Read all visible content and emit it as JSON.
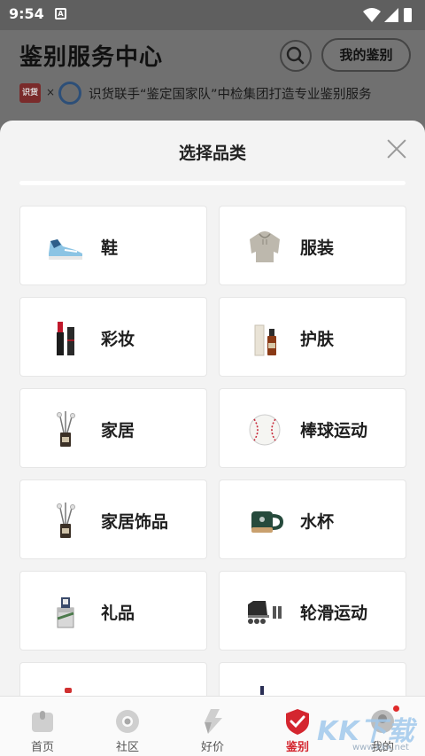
{
  "status_bar": {
    "time": "9:54",
    "notification_glyph": "A"
  },
  "background_page": {
    "title": "鉴别服务中心",
    "my_button": "我的鉴别",
    "banner_x": "×",
    "banner_text": "识货联手“鉴定国家队”中检集团打造专业鉴别服务"
  },
  "sheet": {
    "title": "选择品类",
    "categories": [
      {
        "label": "鞋",
        "icon": "sneaker-icon"
      },
      {
        "label": "服装",
        "icon": "hoodie-icon"
      },
      {
        "label": "彩妆",
        "icon": "lipstick-icon"
      },
      {
        "label": "护肤",
        "icon": "serum-bottle-icon"
      },
      {
        "label": "家居",
        "icon": "diffuser-icon"
      },
      {
        "label": "棒球运动",
        "icon": "baseball-icon"
      },
      {
        "label": "家居饰品",
        "icon": "diffuser-icon"
      },
      {
        "label": "水杯",
        "icon": "mug-icon"
      },
      {
        "label": "礼品",
        "icon": "gift-icon"
      },
      {
        "label": "轮滑运动",
        "icon": "skate-icon"
      }
    ]
  },
  "tab_bar": {
    "tabs": [
      {
        "label": "首页",
        "icon": "home-icon",
        "active": false
      },
      {
        "label": "社区",
        "icon": "community-icon",
        "active": false
      },
      {
        "label": "好价",
        "icon": "lightning-icon",
        "active": false
      },
      {
        "label": "鉴别",
        "icon": "shield-check-icon",
        "active": true
      },
      {
        "label": "我的",
        "icon": "profile-icon",
        "active": false
      }
    ]
  },
  "watermark": {
    "text": "KK下载",
    "url": "www.kkx.net"
  },
  "colors": {
    "accent": "#d4262f",
    "sheet_bg": "#f3f3f3",
    "overlay": "#6f6f6f"
  }
}
